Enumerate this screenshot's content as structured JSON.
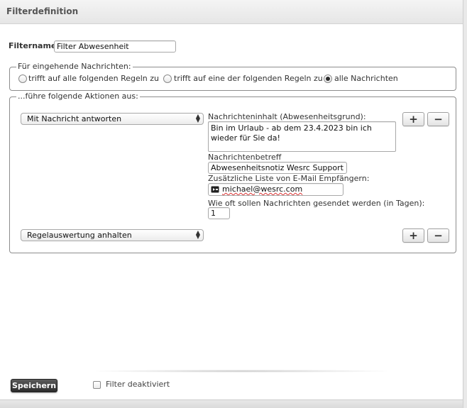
{
  "header": {
    "title": "Filterdefinition"
  },
  "filtername": {
    "label": "Filtername:",
    "value": "Filter Abwesenheit"
  },
  "incoming": {
    "legend": "Für eingehende Nachrichten:",
    "options": [
      {
        "label": "trifft auf alle folgenden Regeln zu",
        "checked": false
      },
      {
        "label": "trifft auf eine der folgenden Regeln zu",
        "checked": false
      },
      {
        "label": "alle Nachrichten",
        "checked": true
      }
    ]
  },
  "actions": {
    "legend": "...führe folgende Aktionen aus:",
    "rule1": {
      "action": "Mit Nachricht antworten",
      "content_label": "Nachrichteninhalt (Abwesenheitsgrund):",
      "content_value": "Bin im Urlaub - ab dem 23.4.2023 bin ich wieder für Sie da!",
      "subject_label": "Nachrichtenbetreff",
      "subject_value": "Abwesenheitsnotiz Wesrc Support",
      "recipients_label": "Zusätzliche Liste von E-Mail Empfängern:",
      "recipients_value": "michael@wesrc.com",
      "frequency_label": "Wie oft sollen Nachrichten gesendet werden (in Tagen):",
      "frequency_value": "1",
      "add_label": "+",
      "remove_label": "−"
    },
    "rule2": {
      "action": "Regelauswertung anhalten",
      "add_label": "+",
      "remove_label": "−"
    }
  },
  "footer": {
    "save_label": "Speichern",
    "disabled_label": "Filter deaktiviert",
    "disabled_checked": false
  }
}
